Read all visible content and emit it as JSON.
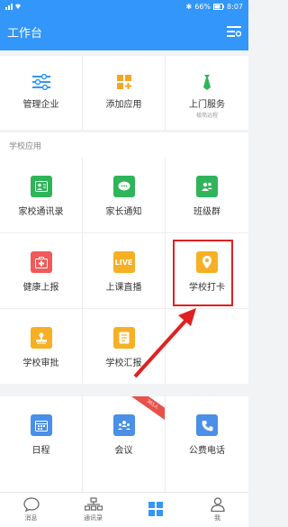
{
  "statusbar": {
    "battery": "66%",
    "time": "8:07"
  },
  "header": {
    "title": "工作台"
  },
  "top_apps": [
    {
      "label": "管理企业",
      "icon": "sliders-icon"
    },
    {
      "label": "添加应用",
      "icon": "apps-plus-icon"
    },
    {
      "label": "上门服务",
      "sub": "极简远程",
      "icon": "tie-icon"
    }
  ],
  "school": {
    "title": "学校应用",
    "items": [
      {
        "label": "家校通讯录",
        "icon": "contacts-icon",
        "color": "#2fb45a"
      },
      {
        "label": "家长通知",
        "icon": "chat-icon",
        "color": "#2fb45a"
      },
      {
        "label": "班级群",
        "icon": "group-icon",
        "color": "#2fb45a"
      },
      {
        "label": "健康上报",
        "icon": "medical-kit-icon",
        "color": "#f05a5a"
      },
      {
        "label": "上课直播",
        "icon": "live-icon",
        "badge": "LIVE",
        "color": "#f7b024"
      },
      {
        "label": "学校打卡",
        "icon": "location-pin-icon",
        "color": "#f7b024"
      },
      {
        "label": "学校审批",
        "icon": "stamp-icon",
        "color": "#f7b024"
      },
      {
        "label": "学校汇报",
        "icon": "report-icon",
        "color": "#f7b024"
      }
    ]
  },
  "common": [
    {
      "label": "日程",
      "icon": "calendar-icon",
      "color": "#4a8fe8"
    },
    {
      "label": "会议",
      "icon": "meeting-icon",
      "color": "#4a8fe8",
      "ribbon": "365人"
    },
    {
      "label": "公费电话",
      "icon": "phone-icon",
      "color": "#4a8fe8"
    }
  ],
  "tabs": [
    {
      "label": "消息",
      "icon": "message-icon"
    },
    {
      "label": "通讯录",
      "icon": "org-chart-icon"
    },
    {
      "label": "",
      "icon": "workbench-icon",
      "active": true
    },
    {
      "label": "我",
      "icon": "person-icon"
    }
  ]
}
